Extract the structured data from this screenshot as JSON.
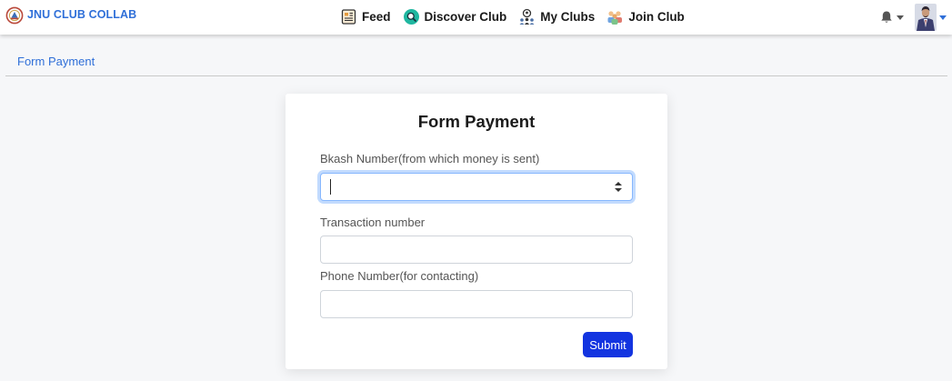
{
  "colors": {
    "brand": "#2f6fd8",
    "submit": "#1334e0",
    "background": "#f6f7f9"
  },
  "navbar": {
    "brand": {
      "text": "JNU CLUB COLLAB",
      "icon": "club-logo-icon"
    },
    "links": [
      {
        "label": "Feed",
        "icon": "feed-icon"
      },
      {
        "label": "Discover Club",
        "icon": "discover-icon"
      },
      {
        "label": "My Clubs",
        "icon": "my-clubs-icon"
      },
      {
        "label": "Join Club",
        "icon": "join-club-icon"
      }
    ],
    "notifications": {
      "icon": "bell-icon"
    },
    "profile": {
      "icon": "avatar-icon"
    }
  },
  "breadcrumb": {
    "label": "Form Payment"
  },
  "form": {
    "title": "Form Payment",
    "fields": [
      {
        "label": "Bkash Number(from which money is sent)",
        "value": "",
        "placeholder": "",
        "type": "number"
      },
      {
        "label": "Transaction number",
        "value": "",
        "placeholder": "",
        "type": "text"
      },
      {
        "label": "Phone Number(for contacting)",
        "value": "",
        "placeholder": "",
        "type": "text"
      }
    ],
    "submit_label": "Submit"
  }
}
